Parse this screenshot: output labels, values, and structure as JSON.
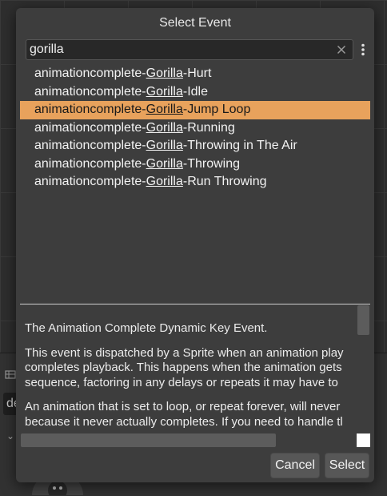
{
  "dialog": {
    "title": "Select Event"
  },
  "search": {
    "value": "gorilla",
    "placeholder": ""
  },
  "events": [
    {
      "prefix": "animationcomplete-",
      "match": "Gorilla",
      "suffix": "-Hurt",
      "selected": false
    },
    {
      "prefix": "animationcomplete-",
      "match": "Gorilla",
      "suffix": "-Idle",
      "selected": false
    },
    {
      "prefix": "animationcomplete-",
      "match": "Gorilla",
      "suffix": "-Jump Loop",
      "selected": true
    },
    {
      "prefix": "animationcomplete-",
      "match": "Gorilla",
      "suffix": "-Running",
      "selected": false
    },
    {
      "prefix": "animationcomplete-",
      "match": "Gorilla",
      "suffix": "-Throwing in The Air",
      "selected": false
    },
    {
      "prefix": "animationcomplete-",
      "match": "Gorilla",
      "suffix": "-Throwing",
      "selected": false
    },
    {
      "prefix": "animationcomplete-",
      "match": "Gorilla",
      "suffix": "-Run Throwing",
      "selected": false
    }
  ],
  "description": {
    "paragraphs": [
      [
        "The Animation Complete Dynamic Key Event."
      ],
      [
        "This event is dispatched by a Sprite when an animation play",
        "completes playback. This happens when the animation gets",
        "sequence, factoring in any delays or repeats it may have to"
      ],
      [
        "An animation that is set to loop, or repeat forever, will never",
        "because it never actually completes. If you need to handle tl"
      ]
    ]
  },
  "buttons": {
    "cancel": "Cancel",
    "select": "Select"
  },
  "background": {
    "field_text": "de"
  },
  "colors": {
    "selection": "#e8a25c",
    "dialog_bg": "#3d3d3d"
  }
}
